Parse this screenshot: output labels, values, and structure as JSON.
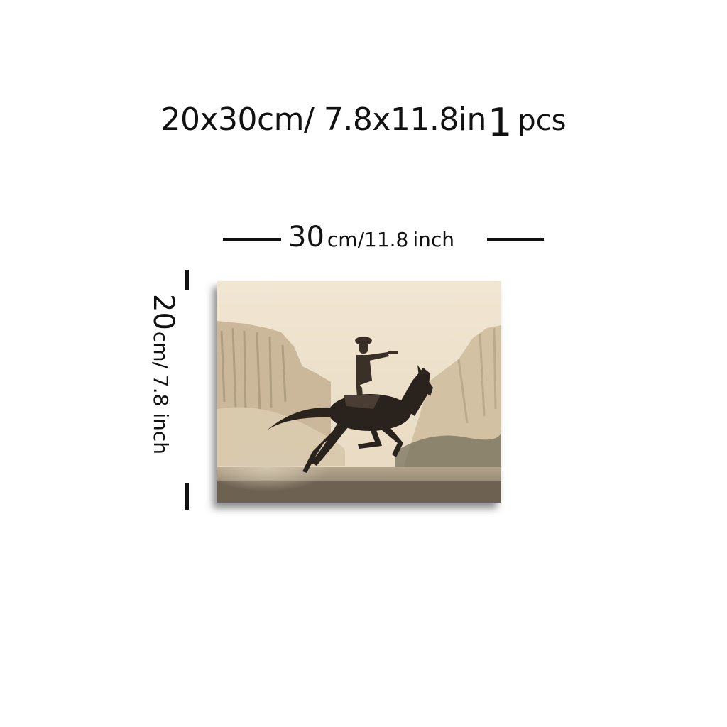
{
  "headline": {
    "size": "20x30cm/ 7.8x11.8in",
    "quantity": "1",
    "unit": "pcs"
  },
  "width_dimension": {
    "value": "30",
    "unit": "cm/",
    "value_in": "11.8",
    "unit_in": "inch"
  },
  "height_dimension": {
    "value": "20",
    "unit": "cm/ 7.8 inch"
  },
  "product_image": {
    "subject": "sepia photo of a cowboy on a galloping horse in a canyon",
    "colors": {
      "sky": "#efe3cf",
      "cliff": "#cdbb9c",
      "horse": "#2a221c",
      "ground": "#8c7e6b"
    }
  }
}
